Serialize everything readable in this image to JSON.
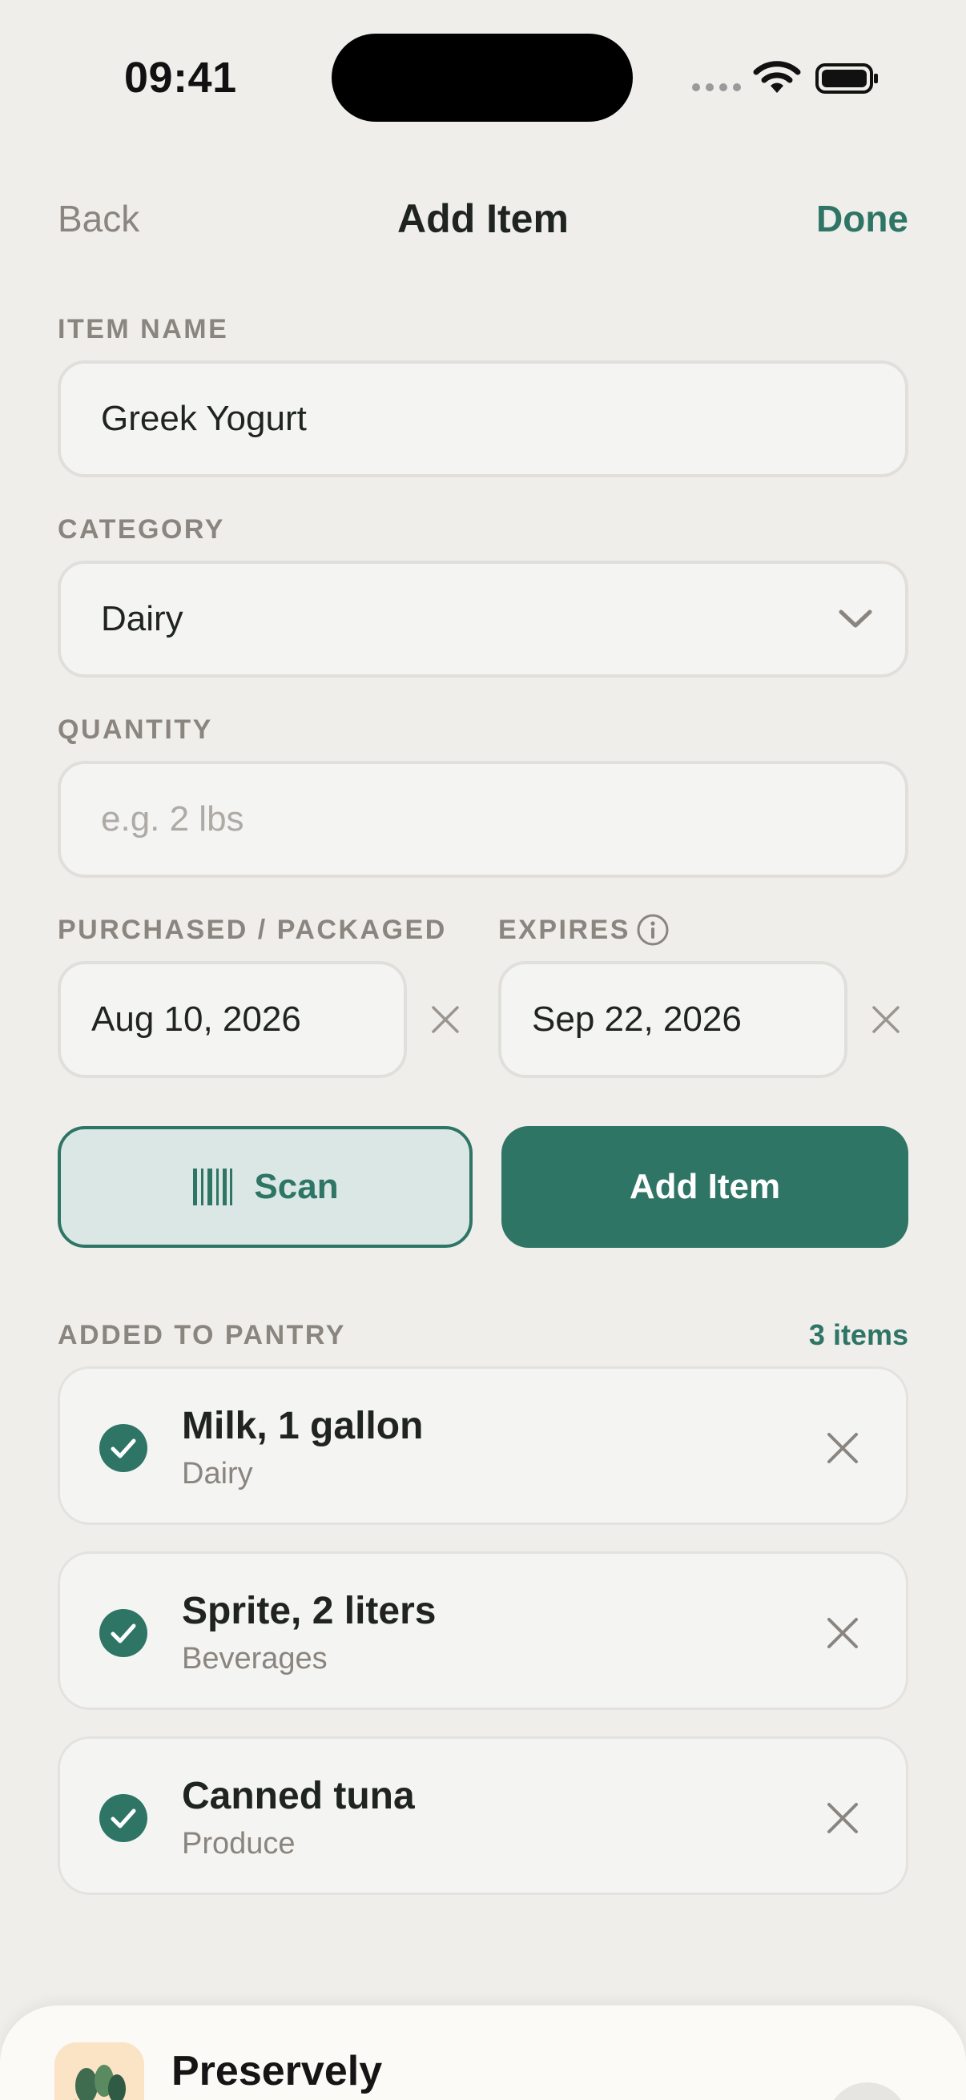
{
  "status_bar": {
    "time": "09:41"
  },
  "nav": {
    "back_label": "Back",
    "title": "Add Item",
    "done_label": "Done"
  },
  "form": {
    "item_name": {
      "label": "ITEM NAME",
      "value": "Greek Yogurt"
    },
    "category": {
      "label": "CATEGORY",
      "value": "Dairy"
    },
    "quantity": {
      "label": "QUANTITY",
      "value": "",
      "placeholder": "e.g. 2 lbs"
    },
    "purchased": {
      "label": "PURCHASED / PACKAGED",
      "value": "Aug 10, 2026"
    },
    "expires": {
      "label": "EXPIRES",
      "value": "Sep 22, 2026"
    }
  },
  "actions": {
    "scan_label": "Scan",
    "add_label": "Add Item"
  },
  "pantry": {
    "header": "ADDED TO PANTRY",
    "count": "3 items",
    "items": [
      {
        "name": "Milk, 1 gallon",
        "category": "Dairy"
      },
      {
        "name": "Sprite, 2 liters",
        "category": "Beverages"
      },
      {
        "name": "Canned tuna",
        "category": "Produce"
      }
    ]
  },
  "sheet": {
    "app_name": "Preservely"
  },
  "colors": {
    "accent": "#2e7566",
    "background": "#efeeeb",
    "muted": "#8a857e"
  },
  "icons": [
    "wifi-icon",
    "battery-icon",
    "chevron-down-icon",
    "info-icon",
    "clear-icon",
    "barcode-icon",
    "check-icon",
    "close-icon",
    "app-icon"
  ]
}
